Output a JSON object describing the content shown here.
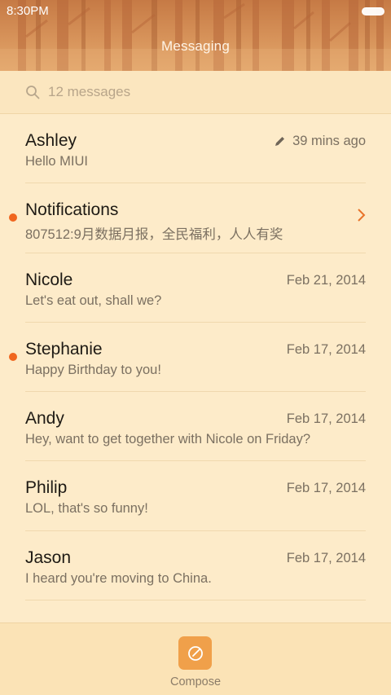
{
  "status_bar": {
    "time": "8:30PM"
  },
  "header": {
    "title": "Messaging"
  },
  "search": {
    "placeholder": "12 messages"
  },
  "conversations": [
    {
      "name": "Ashley",
      "preview": "Hello MIUI",
      "time": "39 mins ago",
      "draft": true,
      "unread": false
    },
    {
      "name": "Notifications",
      "preview": "807512:9月数据月报，全民福利，人人有奖",
      "time": "",
      "unread": true,
      "has_chevron": true
    },
    {
      "name": "Nicole",
      "preview": "Let's eat out, shall we?",
      "time": "Feb 21, 2014",
      "unread": false
    },
    {
      "name": "Stephanie",
      "preview": "Happy Birthday to you!",
      "time": "Feb 17, 2014",
      "unread": true
    },
    {
      "name": "Andy",
      "preview": "Hey, want to get together with Nicole on Friday?",
      "time": "Feb 17, 2014",
      "unread": false
    },
    {
      "name": "Philip",
      "preview": "LOL, that's so funny!",
      "time": "Feb 17, 2014",
      "unread": false
    },
    {
      "name": "Jason",
      "preview": "I heard you're moving to China.",
      "time": "Feb 17, 2014",
      "unread": false
    }
  ],
  "bottom_bar": {
    "compose_label": "Compose"
  },
  "colors": {
    "accent": "#f0a04a",
    "unread_dot": "#f0661f",
    "background": "#fdebc9"
  }
}
